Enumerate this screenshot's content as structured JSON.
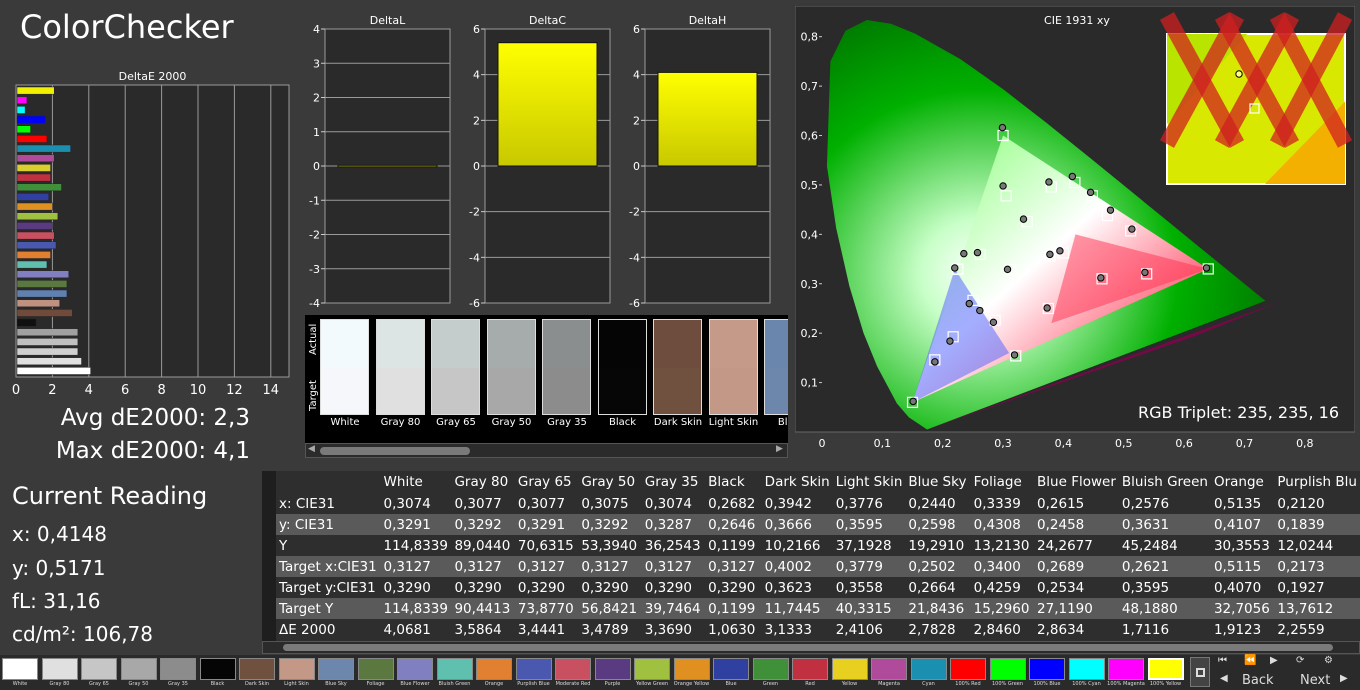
{
  "app_title": "ColorChecker",
  "summary": {
    "avg": "Avg dE2000: 2,3",
    "max": "Max dE2000: 4,1"
  },
  "current_reading": {
    "title": "Current Reading",
    "x": "x: 0,4148",
    "y": "y: 0,5171",
    "fl": "fL: 31,16",
    "cdm2": "cd/m²: 106,78"
  },
  "chart_data": [
    {
      "type": "bar",
      "title": "DeltaE 2000",
      "orientation": "horizontal",
      "xlim": [
        0,
        15
      ],
      "xticks": [
        "0",
        "2",
        "4",
        "6",
        "8",
        "10",
        "12",
        "14"
      ],
      "bars": [
        {
          "value": 2.1,
          "color": "#f0f000"
        },
        {
          "value": 0.6,
          "color": "#ff00ff"
        },
        {
          "value": 0.5,
          "color": "#00ffff"
        },
        {
          "value": 1.6,
          "color": "#0000ff"
        },
        {
          "value": 0.8,
          "color": "#00ff00"
        },
        {
          "value": 1.7,
          "color": "#ff0000"
        },
        {
          "value": 3.0,
          "color": "#1a8fb0"
        },
        {
          "value": 2.1,
          "color": "#b04a9a"
        },
        {
          "value": 1.9,
          "color": "#d9d030"
        },
        {
          "value": 1.9,
          "color": "#c03040"
        },
        {
          "value": 2.5,
          "color": "#40903a"
        },
        {
          "value": 1.8,
          "color": "#3040a0"
        },
        {
          "value": 2.0,
          "color": "#e09020"
        },
        {
          "value": 2.3,
          "color": "#a0c040"
        },
        {
          "value": 2.0,
          "color": "#5a3a80"
        },
        {
          "value": 2.1,
          "color": "#c85060"
        },
        {
          "value": 2.2,
          "color": "#4a58b0"
        },
        {
          "value": 1.9,
          "color": "#e08030"
        },
        {
          "value": 1.7,
          "color": "#60c0b0"
        },
        {
          "value": 2.9,
          "color": "#8080c0"
        },
        {
          "value": 2.8,
          "color": "#5a7840"
        },
        {
          "value": 2.8,
          "color": "#6080b0"
        },
        {
          "value": 2.4,
          "color": "#c09080"
        },
        {
          "value": 3.1,
          "color": "#704a3a"
        },
        {
          "value": 1.1,
          "color": "#101010"
        },
        {
          "value": 3.4,
          "color": "#a0a0a0"
        },
        {
          "value": 3.4,
          "color": "#c0c0c0"
        },
        {
          "value": 3.4,
          "color": "#d0d0d0"
        },
        {
          "value": 3.6,
          "color": "#e0e0e0"
        },
        {
          "value": 4.1,
          "color": "#ffffff"
        }
      ]
    },
    {
      "type": "bar",
      "title": "DeltaL",
      "ylim": [
        -4,
        4
      ],
      "yticks": [
        "4",
        "3",
        "2",
        "1",
        "0",
        "-1",
        "-2",
        "-3",
        "-4"
      ],
      "values": [
        0.02
      ]
    },
    {
      "type": "bar",
      "title": "DeltaC",
      "ylim": [
        -6,
        6
      ],
      "yticks": [
        "6",
        "4",
        "2",
        "0",
        "-2",
        "-4",
        "-6"
      ],
      "values": [
        5.4
      ]
    },
    {
      "type": "bar",
      "title": "DeltaH",
      "ylim": [
        -6,
        6
      ],
      "yticks": [
        "6",
        "4",
        "2",
        "0",
        "-2",
        "-4",
        "-6"
      ],
      "values": [
        4.1
      ]
    },
    {
      "type": "scatter",
      "title": "CIE 1931 xy",
      "xlim": [
        0,
        0.85
      ],
      "ylim": [
        0,
        0.85
      ],
      "xticks": [
        "0",
        "0,1",
        "0,2",
        "0,3",
        "0,4",
        "0,5",
        "0,6",
        "0,7",
        "0,8"
      ],
      "yticks": [
        "0,1",
        "0,2",
        "0,3",
        "0,4",
        "0,5",
        "0,6",
        "0,7",
        "0,8"
      ],
      "gamut": [
        [
          0.64,
          0.33
        ],
        [
          0.3,
          0.6
        ],
        [
          0.15,
          0.06
        ]
      ],
      "targets": [
        [
          0.3127,
          0.329
        ],
        [
          0.4002,
          0.3623
        ],
        [
          0.3779,
          0.3558
        ],
        [
          0.2502,
          0.2664
        ],
        [
          0.34,
          0.4259
        ],
        [
          0.2689,
          0.2534
        ],
        [
          0.2621,
          0.3595
        ],
        [
          0.5115,
          0.407
        ],
        [
          0.2173,
          0.1927
        ],
        [
          0.464,
          0.31
        ],
        [
          0.287,
          0.226
        ],
        [
          0.38,
          0.496
        ],
        [
          0.473,
          0.438
        ],
        [
          0.187,
          0.146
        ],
        [
          0.305,
          0.478
        ],
        [
          0.538,
          0.32
        ],
        [
          0.448,
          0.478
        ],
        [
          0.375,
          0.25
        ],
        [
          0.225,
          0.33
        ],
        [
          0.64,
          0.33
        ],
        [
          0.3,
          0.6
        ],
        [
          0.15,
          0.06
        ],
        [
          0.225,
          0.329
        ],
        [
          0.321,
          0.154
        ],
        [
          0.419,
          0.505
        ]
      ],
      "measured": [
        [
          0.3074,
          0.3291
        ],
        [
          0.3942,
          0.3666
        ],
        [
          0.3776,
          0.3595
        ],
        [
          0.244,
          0.2598
        ],
        [
          0.3339,
          0.4308
        ],
        [
          0.2615,
          0.2458
        ],
        [
          0.2576,
          0.3631
        ],
        [
          0.5135,
          0.4107
        ],
        [
          0.212,
          0.1839
        ],
        [
          0.462,
          0.312
        ],
        [
          0.284,
          0.222
        ],
        [
          0.376,
          0.506
        ],
        [
          0.478,
          0.449
        ],
        [
          0.187,
          0.142
        ],
        [
          0.3,
          0.498
        ],
        [
          0.535,
          0.323
        ],
        [
          0.445,
          0.485
        ],
        [
          0.373,
          0.251
        ],
        [
          0.22,
          0.332
        ],
        [
          0.637,
          0.332
        ],
        [
          0.299,
          0.616
        ],
        [
          0.151,
          0.062
        ],
        [
          0.235,
          0.361
        ],
        [
          0.319,
          0.156
        ],
        [
          0.4148,
          0.5171
        ]
      ],
      "annotation": "RGB Triplet: 235, 235, 16"
    }
  ],
  "patches": {
    "labels": [
      "White",
      "Gray 80",
      "Gray 65",
      "Gray 50",
      "Gray 35",
      "Black",
      "Dark Skin",
      "Light Skin",
      "Blue"
    ],
    "actual": [
      "#f2fafe",
      "#dde4e4",
      "#c4cccc",
      "#a6acac",
      "#8a8e8e",
      "#050505",
      "#6e4d3e",
      "#c69a88",
      "#6b86ad"
    ],
    "target": [
      "#f5f7fb",
      "#e0e0e0",
      "#c6c6c6",
      "#a8a8a8",
      "#8c8c8c",
      "#060606",
      "#70503f",
      "#c49886",
      "#6d86ab"
    ],
    "axis_actual": "Actual",
    "axis_target": "Target"
  },
  "table": {
    "headers": [
      "",
      "White",
      "Gray 80",
      "Gray 65",
      "Gray 50",
      "Gray 35",
      "Black",
      "Dark Skin",
      "Light Skin",
      "Blue Sky",
      "Foliage",
      "Blue Flower",
      "Bluish Green",
      "Orange",
      "Purplish Blu"
    ],
    "rows": [
      [
        "x: CIE31",
        "0,3074",
        "0,3077",
        "0,3077",
        "0,3075",
        "0,3074",
        "0,2682",
        "0,3942",
        "0,3776",
        "0,2440",
        "0,3339",
        "0,2615",
        "0,2576",
        "0,5135",
        "0,2120"
      ],
      [
        "y: CIE31",
        "0,3291",
        "0,3292",
        "0,3291",
        "0,3292",
        "0,3287",
        "0,2646",
        "0,3666",
        "0,3595",
        "0,2598",
        "0,4308",
        "0,2458",
        "0,3631",
        "0,4107",
        "0,1839"
      ],
      [
        "Y",
        "114,8339",
        "89,0440",
        "70,6315",
        "53,3940",
        "36,2543",
        "0,1199",
        "10,2166",
        "37,1928",
        "19,2910",
        "13,2130",
        "24,2677",
        "45,2484",
        "30,3553",
        "12,0244"
      ],
      [
        "Target x:CIE31",
        "0,3127",
        "0,3127",
        "0,3127",
        "0,3127",
        "0,3127",
        "0,3127",
        "0,4002",
        "0,3779",
        "0,2502",
        "0,3400",
        "0,2689",
        "0,2621",
        "0,5115",
        "0,2173"
      ],
      [
        "Target y:CIE31",
        "0,3290",
        "0,3290",
        "0,3290",
        "0,3290",
        "0,3290",
        "0,3290",
        "0,3623",
        "0,3558",
        "0,2664",
        "0,4259",
        "0,2534",
        "0,3595",
        "0,4070",
        "0,1927"
      ],
      [
        "Target Y",
        "114,8339",
        "90,4413",
        "73,8770",
        "56,8421",
        "39,7464",
        "0,1199",
        "11,7445",
        "40,3315",
        "21,8436",
        "15,2960",
        "27,1190",
        "48,1880",
        "32,7056",
        "13,7612"
      ],
      [
        "ΔE 2000",
        "4,0681",
        "3,5864",
        "3,4441",
        "3,4789",
        "3,3690",
        "1,0630",
        "3,1333",
        "2,4106",
        "2,7828",
        "2,8460",
        "2,8634",
        "1,7116",
        "1,9123",
        "2,2559"
      ]
    ]
  },
  "swatches": [
    {
      "name": "White",
      "color": "#ffffff"
    },
    {
      "name": "Gray 80",
      "color": "#e0e0e0"
    },
    {
      "name": "Gray 65",
      "color": "#c6c6c6"
    },
    {
      "name": "Gray 50",
      "color": "#a8a8a8"
    },
    {
      "name": "Gray 35",
      "color": "#8c8c8c"
    },
    {
      "name": "Black",
      "color": "#050505"
    },
    {
      "name": "Dark Skin",
      "color": "#70503f"
    },
    {
      "name": "Light Skin",
      "color": "#c49886"
    },
    {
      "name": "Blue Sky",
      "color": "#6d86ab"
    },
    {
      "name": "Foliage",
      "color": "#5a7840"
    },
    {
      "name": "Blue Flower",
      "color": "#8080c0"
    },
    {
      "name": "Bluish Green",
      "color": "#60c0b0"
    },
    {
      "name": "Orange",
      "color": "#e08030"
    },
    {
      "name": "Purplish Blue",
      "color": "#4a58b0"
    },
    {
      "name": "Moderate Red",
      "color": "#c85060"
    },
    {
      "name": "Purple",
      "color": "#5a3a80"
    },
    {
      "name": "Yellow Green",
      "color": "#a0c040"
    },
    {
      "name": "Orange Yellow",
      "color": "#e09020"
    },
    {
      "name": "Blue",
      "color": "#3040a0"
    },
    {
      "name": "Green",
      "color": "#40903a"
    },
    {
      "name": "Red",
      "color": "#c03040"
    },
    {
      "name": "Yellow",
      "color": "#e8d020"
    },
    {
      "name": "Magenta",
      "color": "#b04a9a"
    },
    {
      "name": "Cyan",
      "color": "#1a8fb0"
    },
    {
      "name": "100% Red",
      "color": "#ff0000"
    },
    {
      "name": "100% Green",
      "color": "#00ff00"
    },
    {
      "name": "100% Blue",
      "color": "#0000ff"
    },
    {
      "name": "100% Cyan",
      "color": "#00ffff"
    },
    {
      "name": "100% Magenta",
      "color": "#ff00ff"
    },
    {
      "name": "100% Yellow",
      "color": "#ffff00"
    }
  ],
  "nav": {
    "back": "Back",
    "next": "Next"
  },
  "colors": {
    "accent_yellow": "#f0f000",
    "panel_bg": "#2a2a2a",
    "grid": "#9a9a9a"
  }
}
